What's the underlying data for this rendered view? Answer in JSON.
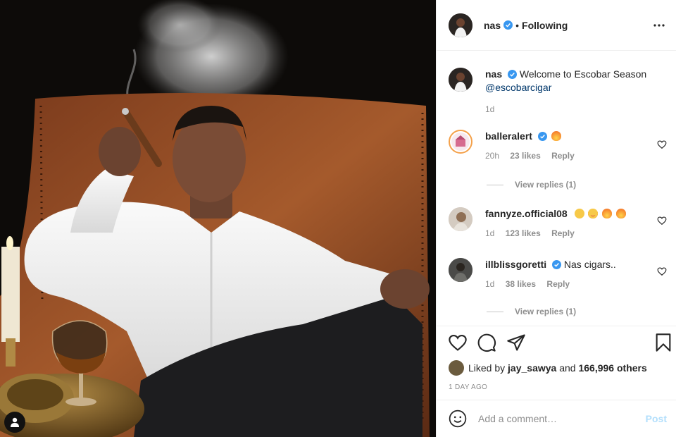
{
  "post": {
    "user_tag_icon": "person-icon",
    "photo_description_icon": "photo"
  },
  "header": {
    "username": "nas",
    "separator": "•",
    "follow_label": "Following",
    "more_icon": "more-dots-icon"
  },
  "caption": {
    "username": "nas",
    "text": "Welcome to Escobar Season",
    "mention": "@escobarcigar",
    "time": "1d"
  },
  "comments": [
    {
      "username": "balleralert",
      "verified": true,
      "text": "",
      "emoji": [
        "fire"
      ],
      "time": "20h",
      "likes": "23 likes",
      "reply": "Reply",
      "view_replies": "View replies (1)"
    },
    {
      "username": "fannyze.official08",
      "verified": false,
      "text": "",
      "emoji": [
        "face",
        "heart-eyes",
        "fire",
        "fire"
      ],
      "time": "1d",
      "likes": "123 likes",
      "reply": "Reply"
    },
    {
      "username": "illblissgoretti",
      "verified": true,
      "text": "Nas cigars..",
      "emoji": [],
      "time": "1d",
      "likes": "38 likes",
      "reply": "Reply",
      "view_replies": "View replies (1)"
    }
  ],
  "actions": {
    "like_icon": "heart-icon",
    "comment_icon": "comment-icon",
    "share_icon": "share-icon",
    "save_icon": "bookmark-icon"
  },
  "likes": {
    "prefix": "Liked by",
    "user": "jay_sawya",
    "and": "and",
    "count": "166,996 others"
  },
  "timestamp": "1 DAY AGO",
  "add_comment": {
    "placeholder": "Add a comment…",
    "post_label": "Post"
  },
  "colors": {
    "verified": "#3897f0",
    "link": "#00376b",
    "muted": "#8e8e8e",
    "post_disabled": "#b2dffc"
  }
}
